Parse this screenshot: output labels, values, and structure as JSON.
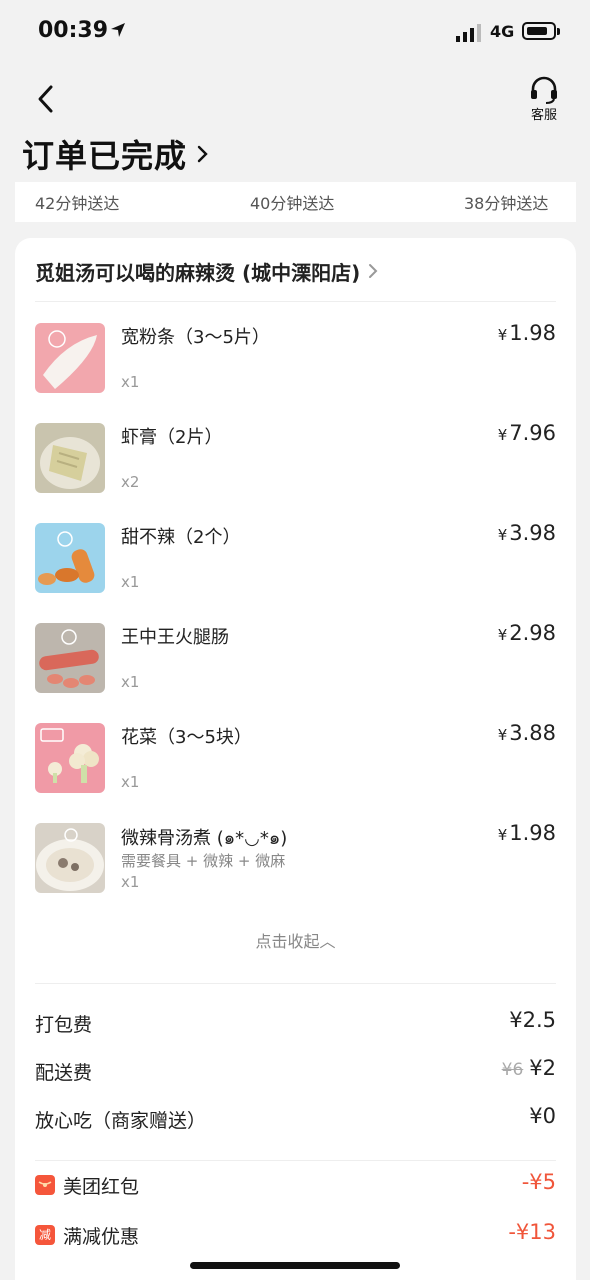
{
  "status_bar": {
    "time": "00:39",
    "network": "4G"
  },
  "header": {
    "service_label": "客服",
    "title": "订单已完成"
  },
  "eta_options": [
    "42分钟送达",
    "40分钟送达",
    "38分钟送达"
  ],
  "shop": {
    "name": "觅姐汤可以喝的麻辣烫 (城中溧阳店)"
  },
  "items": [
    {
      "name": "宽粉条（3～5片）",
      "spec": "",
      "qty": "x1",
      "price": "1.98",
      "thumb_bg": "#f2a7ad"
    },
    {
      "name": "虾膏（2片）",
      "spec": "",
      "qty": "x2",
      "price": "7.96",
      "thumb_bg": "#c9c4ae"
    },
    {
      "name": "甜不辣（2个）",
      "spec": "",
      "qty": "x1",
      "price": "3.98",
      "thumb_bg": "#9cd4ec"
    },
    {
      "name": "王中王火腿肠",
      "spec": "",
      "qty": "x1",
      "price": "2.98",
      "thumb_bg": "#bdb6ad"
    },
    {
      "name": "花菜（3～5块）",
      "spec": "",
      "qty": "x1",
      "price": "3.88",
      "thumb_bg": "#f09aa6"
    },
    {
      "name": "微辣骨汤煮 (๑*◡*๑)",
      "spec": "需要餐具 + 微辣 + 微麻",
      "qty": "x1",
      "price": "1.98",
      "thumb_bg": "#d8d2c8"
    }
  ],
  "currency": "¥",
  "collapse_label": "点击收起︿",
  "fees": [
    {
      "label": "打包费",
      "value": "¥2.5",
      "original": ""
    },
    {
      "label": "配送费",
      "value": "¥2",
      "original": "¥6"
    },
    {
      "label": "放心吃（商家赠送）",
      "value": "¥0",
      "original": ""
    }
  ],
  "discounts": [
    {
      "label": "美团红包",
      "value": "-¥5",
      "icon": "red-packet-icon"
    },
    {
      "label": "满减优惠",
      "value": "-¥13",
      "icon": "discount-icon",
      "icon_text": "减"
    }
  ],
  "colors": {
    "accent_red": "#f0553a",
    "background": "#f2f2f2"
  }
}
